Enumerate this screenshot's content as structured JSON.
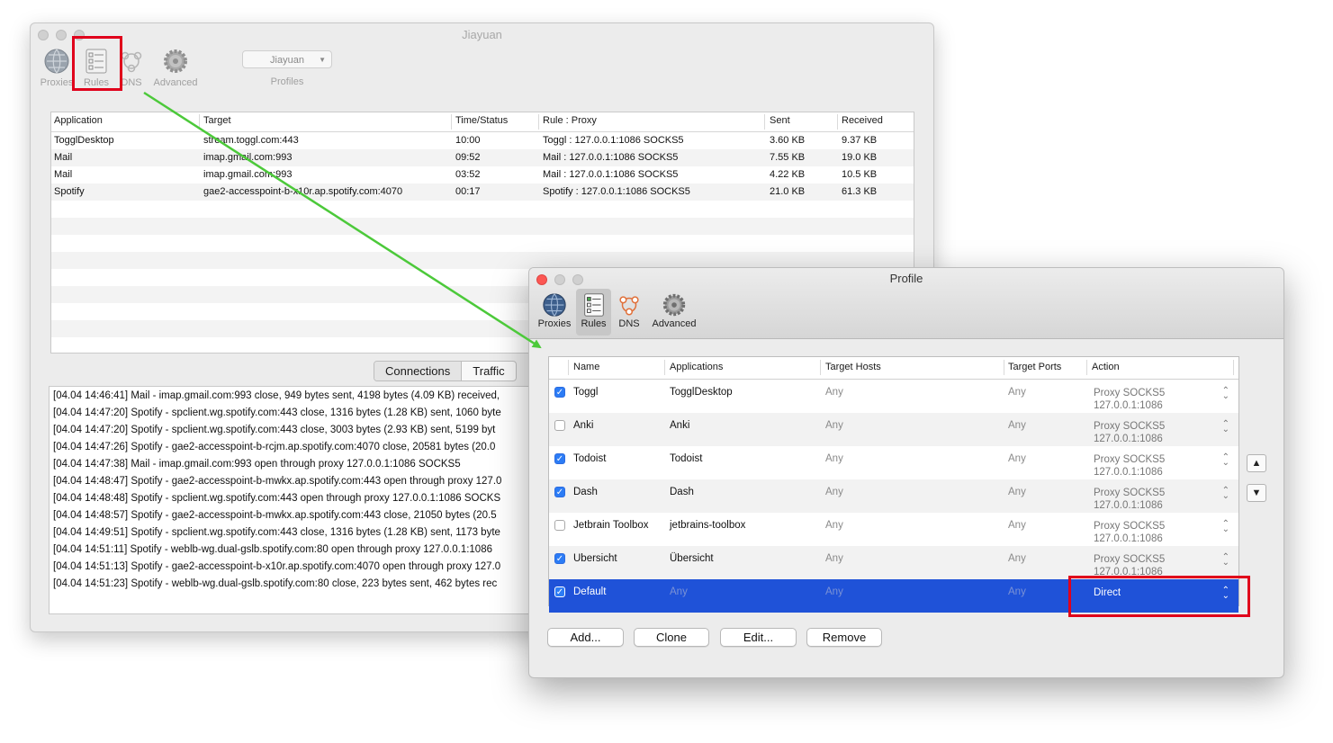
{
  "main_window": {
    "title": "Jiayuan",
    "toolbar": [
      {
        "label": "Proxies",
        "icon": "globe-icon"
      },
      {
        "label": "Rules",
        "icon": "rules-list-icon"
      },
      {
        "label": "DNS",
        "icon": "dns-icon"
      },
      {
        "label": "Advanced",
        "icon": "gear-icon"
      }
    ],
    "profile_select": {
      "value": "Jiayuan",
      "label": "Profiles"
    },
    "connections": {
      "headers": [
        "Application",
        "Target",
        "Time/Status",
        "Rule : Proxy",
        "Sent",
        "Received"
      ],
      "rows": [
        [
          "TogglDesktop",
          "stream.toggl.com:443",
          "10:00",
          "Toggl : 127.0.0.1:1086 SOCKS5",
          "3.60 KB",
          "9.37 KB"
        ],
        [
          "Mail",
          "imap.gmail.com:993",
          "09:52",
          "Mail : 127.0.0.1:1086 SOCKS5",
          "7.55 KB",
          "19.0 KB"
        ],
        [
          "Mail",
          "imap.gmail.com:993",
          "03:52",
          "Mail : 127.0.0.1:1086 SOCKS5",
          "4.22 KB",
          "10.5 KB"
        ],
        [
          "Spotify",
          "gae2-accesspoint-b-x10r.ap.spotify.com:4070",
          "00:17",
          "Spotify : 127.0.0.1:1086 SOCKS5",
          "21.0 KB",
          "61.3 KB"
        ]
      ]
    },
    "tabs": [
      "Connections",
      "Traffic"
    ],
    "log": [
      "[04.04 14:46:41] Mail - imap.gmail.com:993 close, 949 bytes sent, 4198 bytes (4.09 KB) received,",
      "[04.04 14:47:20] Spotify - spclient.wg.spotify.com:443 close, 1316 bytes (1.28 KB) sent, 1060 byte",
      "[04.04 14:47:20] Spotify - spclient.wg.spotify.com:443 close, 3003 bytes (2.93 KB) sent, 5199 byt",
      "[04.04 14:47:26] Spotify - gae2-accesspoint-b-rcjm.ap.spotify.com:4070 close, 20581 bytes (20.0",
      "[04.04 14:47:38] Mail - imap.gmail.com:993 open through proxy 127.0.0.1:1086 SOCKS5",
      "[04.04 14:48:47] Spotify - gae2-accesspoint-b-mwkx.ap.spotify.com:443 open through proxy 127.0",
      "[04.04 14:48:48] Spotify - spclient.wg.spotify.com:443 open through proxy 127.0.0.1:1086 SOCKS",
      "[04.04 14:48:57] Spotify - gae2-accesspoint-b-mwkx.ap.spotify.com:443 close, 21050 bytes (20.5",
      "[04.04 14:49:51] Spotify - spclient.wg.spotify.com:443 close, 1316 bytes (1.28 KB) sent, 1173 byte",
      "[04.04 14:51:11] Spotify - weblb-wg.dual-gslb.spotify.com:80 open through proxy 127.0.0.1:1086",
      "[04.04 14:51:13] Spotify - gae2-accesspoint-b-x10r.ap.spotify.com:4070 open through proxy 127.0",
      "[04.04 14:51:23] Spotify - weblb-wg.dual-gslb.spotify.com:80 close, 223 bytes sent, 462 bytes rec"
    ]
  },
  "profile_window": {
    "title": "Profile",
    "toolbar": [
      {
        "label": "Proxies",
        "icon": "globe-icon"
      },
      {
        "label": "Rules",
        "icon": "rules-list-icon",
        "selected": true
      },
      {
        "label": "DNS",
        "icon": "dns-icon"
      },
      {
        "label": "Advanced",
        "icon": "gear-icon"
      }
    ],
    "rules": {
      "headers": [
        "Name",
        "Applications",
        "Target Hosts",
        "Target Ports",
        "Action"
      ],
      "rows": [
        {
          "checked": true,
          "name": "Toggl",
          "apps": "TogglDesktop",
          "hosts": "Any",
          "ports": "Any",
          "action1": "Proxy SOCKS5",
          "action2": "127.0.0.1:1086"
        },
        {
          "checked": false,
          "name": "Anki",
          "apps": "Anki",
          "hosts": "Any",
          "ports": "Any",
          "action1": "Proxy SOCKS5",
          "action2": "127.0.0.1:1086"
        },
        {
          "checked": true,
          "name": "Todoist",
          "apps": "Todoist",
          "hosts": "Any",
          "ports": "Any",
          "action1": "Proxy SOCKS5",
          "action2": "127.0.0.1:1086"
        },
        {
          "checked": true,
          "name": "Dash",
          "apps": "Dash",
          "hosts": "Any",
          "ports": "Any",
          "action1": "Proxy SOCKS5",
          "action2": "127.0.0.1:1086"
        },
        {
          "checked": false,
          "name": "Jetbrain Toolbox",
          "apps": "jetbrains-toolbox",
          "hosts": "Any",
          "ports": "Any",
          "action1": "Proxy SOCKS5",
          "action2": "127.0.0.1:1086"
        },
        {
          "checked": true,
          "name": "Ubersicht",
          "apps": "Übersicht",
          "hosts": "Any",
          "ports": "Any",
          "action1": "Proxy SOCKS5",
          "action2": "127.0.0.1:1086"
        },
        {
          "checked": true,
          "name": "Default",
          "apps": "Any",
          "hosts": "Any",
          "ports": "Any",
          "action1": "Direct",
          "action2": "",
          "selected": true
        }
      ]
    },
    "buttons": {
      "add": "Add...",
      "clone": "Clone",
      "edit": "Edit...",
      "remove": "Remove",
      "up": "▲",
      "down": "▼"
    }
  },
  "colors": {
    "highlight": "#e0001b",
    "arrow": "#4cc93a",
    "selection": "#1f52d8",
    "checkbox": "#2c7cf5"
  }
}
